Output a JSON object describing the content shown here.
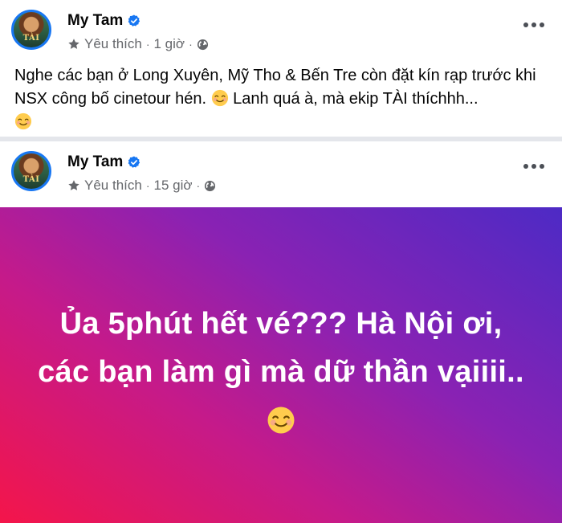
{
  "posts": [
    {
      "author": "My Tam",
      "follow_label": "Yêu thích",
      "time": "1 giờ",
      "text": "Nghe các bạn ở Long Xuyên, Mỹ Tho & Bến Tre còn đặt kín rạp trước khi NSX công bố cinetour hén.",
      "text_2": " Lanh quá à, mà ekip TÀI thíchhh...",
      "avatar_caption": "TÀI"
    },
    {
      "author": "My Tam",
      "follow_label": "Yêu thích",
      "time": "15 giờ",
      "banner_text": "Ủa 5phút hết vé??? Hà Nội ơi, các bạn làm gì mà dữ thần vạiiii..",
      "avatar_caption": "TÀI"
    }
  ],
  "icons": {
    "verified": "verified-badge-icon",
    "star": "star-icon",
    "globe": "globe-icon",
    "more": "more-options-icon",
    "emoji": "smiling-face-emoji"
  },
  "colors": {
    "verified_blue": "#1877f2",
    "meta_gray": "#65676b",
    "banner_start": "#f4154a",
    "banner_end": "#4d2ac5"
  }
}
